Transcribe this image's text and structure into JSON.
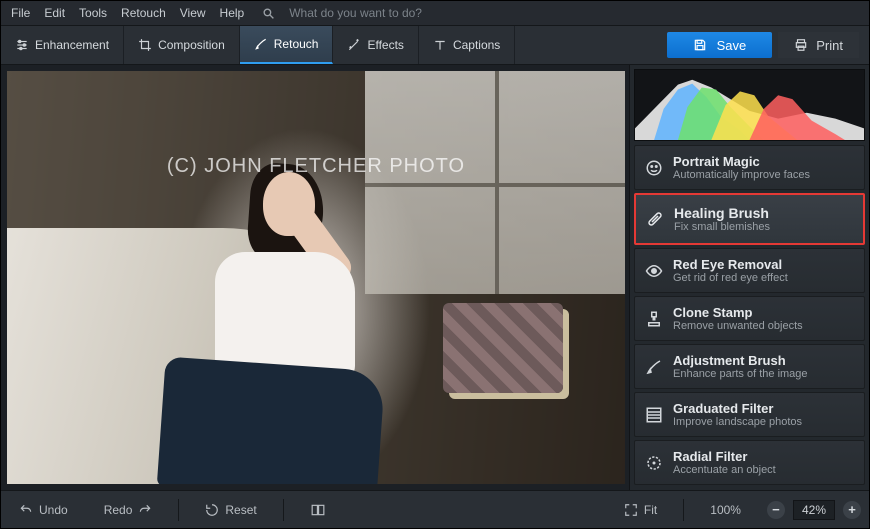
{
  "menu": {
    "items": [
      "File",
      "Edit",
      "Tools",
      "Retouch",
      "View",
      "Help"
    ],
    "search_placeholder": "What do you want to do?"
  },
  "toolbar": {
    "tabs": [
      {
        "label": "Enhancement",
        "active": false
      },
      {
        "label": "Composition",
        "active": false
      },
      {
        "label": "Retouch",
        "active": true
      },
      {
        "label": "Effects",
        "active": false
      },
      {
        "label": "Captions",
        "active": false
      }
    ],
    "save_label": "Save",
    "print_label": "Print"
  },
  "canvas": {
    "watermark": "(C) JOHN FLETCHER PHOTO"
  },
  "tools": [
    {
      "title": "Portrait Magic",
      "desc": "Automatically improve faces",
      "selected": false,
      "icon": "face-icon"
    },
    {
      "title": "Healing Brush",
      "desc": "Fix small blemishes",
      "selected": true,
      "icon": "bandage-icon"
    },
    {
      "title": "Red Eye Removal",
      "desc": "Get rid of red eye effect",
      "selected": false,
      "icon": "eye-icon"
    },
    {
      "title": "Clone Stamp",
      "desc": "Remove unwanted objects",
      "selected": false,
      "icon": "stamp-icon"
    },
    {
      "title": "Adjustment Brush",
      "desc": "Enhance parts of the image",
      "selected": false,
      "icon": "brush-icon"
    },
    {
      "title": "Graduated Filter",
      "desc": "Improve landscape photos",
      "selected": false,
      "icon": "gradient-icon"
    },
    {
      "title": "Radial Filter",
      "desc": "Accentuate an object",
      "selected": false,
      "icon": "radial-icon"
    }
  ],
  "bottom": {
    "undo_label": "Undo",
    "redo_label": "Redo",
    "reset_label": "Reset",
    "fit_label": "Fit",
    "zoom_100": "100%",
    "zoom_val": "42%"
  },
  "colors": {
    "accent": "#1e88e5",
    "highlight": "#e53935"
  }
}
